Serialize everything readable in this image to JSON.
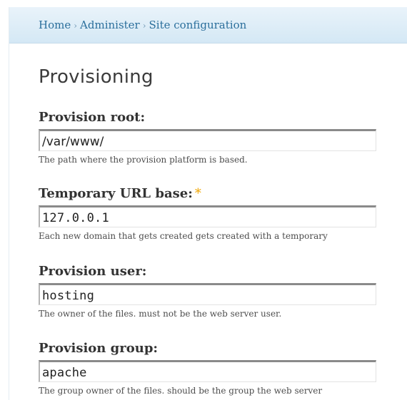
{
  "breadcrumb": {
    "items": [
      "Home",
      "Administer",
      "Site configuration"
    ],
    "separator": "›"
  },
  "page": {
    "title": "Provisioning"
  },
  "fields": [
    {
      "label": "Provision root:",
      "required": false,
      "value": "/var/www/",
      "description": "The path where the provision platform is based."
    },
    {
      "label": "Temporary URL base:",
      "required": true,
      "required_marker": "*",
      "value": "127.0.0.1",
      "description": "Each new domain that gets created gets created with a temporary"
    },
    {
      "label": "Provision user:",
      "required": false,
      "value": "hosting",
      "description": "The owner of the files. must not be the web server user."
    },
    {
      "label": "Provision group:",
      "required": false,
      "value": "apache",
      "description": "The group owner of the files. should be the group the web server"
    }
  ],
  "colors": {
    "link": "#2b6f9c",
    "required_marker": "#f0a500",
    "breadcrumb_bg": "#d4e8f5"
  }
}
